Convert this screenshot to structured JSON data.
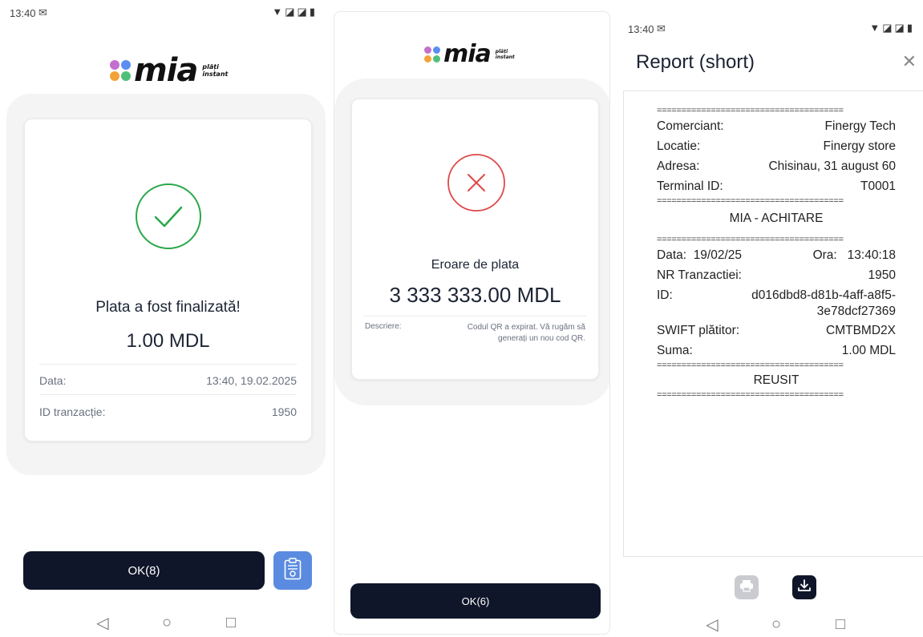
{
  "colors": {
    "dark": "#0f1629",
    "success": "#2aa84a",
    "error": "#e04848",
    "accent_blue": "#5b8be0"
  },
  "logo": {
    "word": "mia",
    "sub_line1": "plăți",
    "sub_line2": "instant"
  },
  "status": {
    "time": "13:40",
    "mail_icon": "ⓜ"
  },
  "screen1": {
    "title": "Plata a fost finalizată!",
    "amount": "1.00 MDL",
    "rows": [
      {
        "label": "Data:",
        "value": "13:40, 19.02.2025"
      },
      {
        "label": "ID tranzacție:",
        "value": "1950"
      }
    ],
    "ok_label": "OK(8)",
    "icon": "check-circle-icon"
  },
  "screen2": {
    "title": "Eroare de plata",
    "amount": "3 333 333.00 MDL",
    "desc_label": "Descriere:",
    "desc_value": "Codul QR a expirat. Vă rugăm să generați un nou cod QR.",
    "ok_label": "OK(6)",
    "icon": "x-circle-icon"
  },
  "screen3": {
    "title": "Report (short)",
    "separator": "======================================",
    "merchant_label": "Comerciant:",
    "merchant_value": "Finergy Tech",
    "location_label": "Locatie:",
    "location_value": "Finergy store",
    "address_label": "Adresa:",
    "address_value": "Chisinau, 31 august 60",
    "terminal_label": "Terminal ID:",
    "terminal_value": "T0001",
    "heading": "MIA - ACHITARE",
    "date_label": "Data:",
    "date_value": "19/02/25",
    "time_label": "Ora:",
    "time_value": "13:40:18",
    "nr_label": "NR Tranzactiei:",
    "nr_value": "1950",
    "id_label": "ID:",
    "id_value_1": "d016dbd8-d81b-4aff-a8f5-",
    "id_value_2": "3e78dcf27369",
    "swift_label": "SWIFT plătitor:",
    "swift_value": "CMTBMD2X",
    "sum_label": "Suma:",
    "sum_value": "1.00 MDL",
    "result": "REUSIT"
  }
}
